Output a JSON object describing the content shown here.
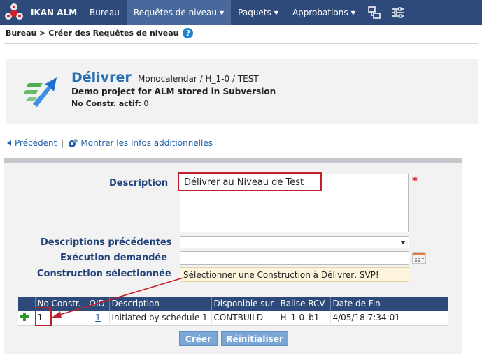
{
  "app": {
    "name": "IKAN ALM"
  },
  "nav": {
    "items": [
      {
        "label": "Bureau",
        "has_dropdown": false
      },
      {
        "label": "Requêtes de niveau",
        "has_dropdown": true
      },
      {
        "label": "Paquets",
        "has_dropdown": true
      },
      {
        "label": "Approbations",
        "has_dropdown": true
      }
    ],
    "active_index": 1
  },
  "breadcrumb": {
    "text": "Bureau > Créer des Requêtes de niveau"
  },
  "header": {
    "title": "Délivrer",
    "path": "Monocalendar / H_1-0 / TEST",
    "project_description": "Demo project for ALM stored in Subversion",
    "no_constr_label": "No Constr. actif:",
    "no_constr_value": "0"
  },
  "links": {
    "previous": "Précédent",
    "more_info": "Montrer les Infos additionnelles"
  },
  "form": {
    "description_label": "Description",
    "description_value": "Délivrer au Niveau de Test",
    "prev_descriptions_label": "Descriptions précédentes",
    "execution_label": "Exécution demandée",
    "build_label": "Construction sélectionnée",
    "build_value": "Sélectionner une Construction à Délivrer, SVP!"
  },
  "table": {
    "headers": [
      "No Constr.",
      "OID",
      "Description",
      "Disponible sur",
      "Balise RCV",
      "Date de Fin"
    ],
    "rows": [
      {
        "no_constr": "1",
        "oid": "1",
        "description": "Initiated by schedule 1",
        "available_on": "CONTBUILD",
        "rcv_tag": "H_1-0_b1",
        "end_date": "4/05/18 7:34:01"
      }
    ]
  },
  "buttons": {
    "create": "Créer",
    "reset": "Réinitialiser"
  },
  "colors": {
    "nav_bg": "#2e4a7a",
    "nav_active": "#49699d",
    "title_blue": "#2a6fb3",
    "label_blue": "#21437a",
    "highlight_red": "#c0202a",
    "button_blue": "#7ba7d6"
  }
}
